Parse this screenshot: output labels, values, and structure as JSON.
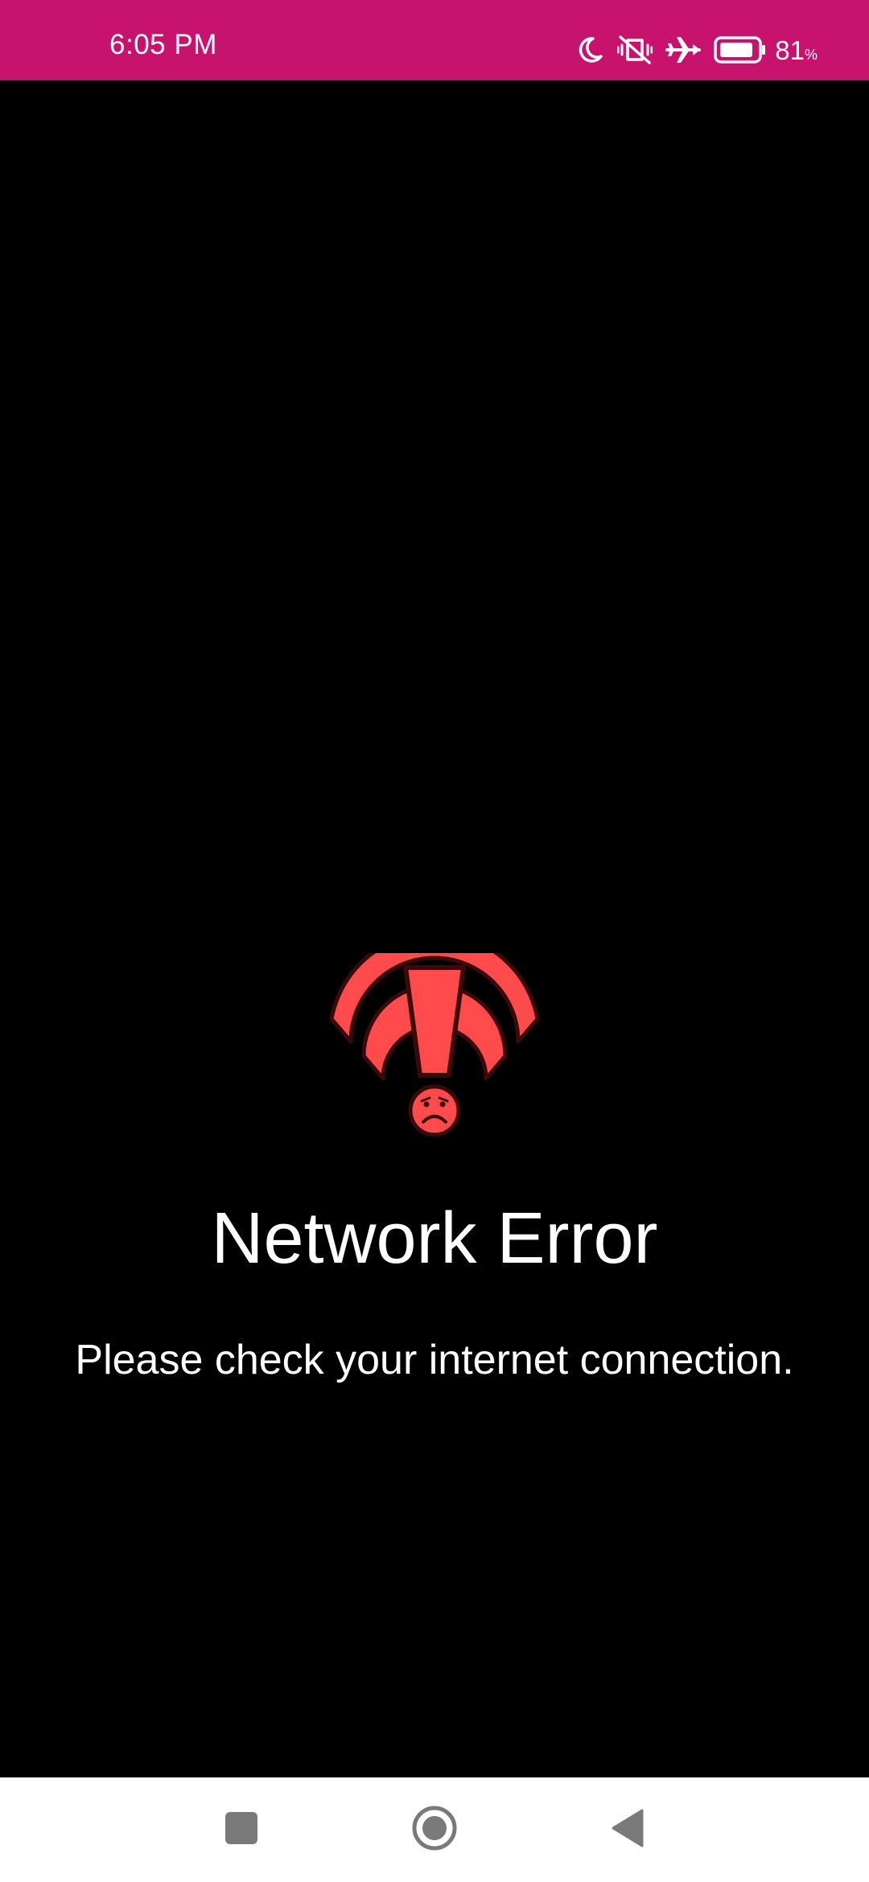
{
  "status_bar": {
    "time": "6:05 PM",
    "battery_level": "81",
    "battery_unit": "%",
    "background_color": "#C8136E",
    "icons": [
      "moon-icon",
      "vibrate-off-icon",
      "airplane-mode-icon",
      "battery-icon"
    ]
  },
  "error": {
    "icon": "wifi-error-icon",
    "icon_color": "#FF4B4B",
    "title": "Network Error",
    "message": "Please check your internet connection."
  },
  "nav_bar": {
    "buttons": [
      "recents-button",
      "home-button",
      "back-button"
    ]
  }
}
